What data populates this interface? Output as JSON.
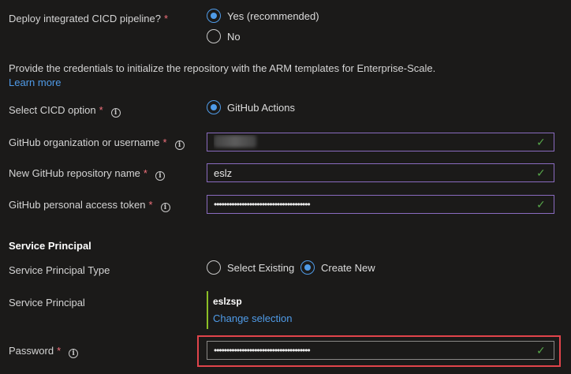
{
  "cicd": {
    "label": "Deploy integrated CICD pipeline?",
    "required_mark": "*",
    "options": [
      {
        "label": "Yes (recommended)",
        "selected": true
      },
      {
        "label": "No",
        "selected": false
      }
    ]
  },
  "description": "Provide the credentials to initialize the repository with the ARM templates for Enterprise-Scale.",
  "learn_more": "Learn more",
  "cicd_option": {
    "label": "Select CICD option",
    "required_mark": "*",
    "info_icon": "i",
    "options": [
      {
        "label": "GitHub Actions",
        "selected": true
      }
    ]
  },
  "github_org": {
    "label": "GitHub organization or username",
    "required_mark": "*",
    "info_icon": "i"
  },
  "github_repo": {
    "label": "New GitHub repository name",
    "required_mark": "*",
    "info_icon": "i",
    "value": "eslz"
  },
  "github_token": {
    "label": "GitHub personal access token",
    "required_mark": "*",
    "info_icon": "i",
    "value": "••••••••••••••••••••••••••••••••••••••"
  },
  "service_principal_section": {
    "heading": "Service Principal",
    "type_label": "Service Principal Type",
    "type_options": [
      {
        "label": "Select Existing",
        "selected": false
      },
      {
        "label": "Create New",
        "selected": true
      }
    ],
    "sp_label": "Service Principal",
    "sp_name": "eslzsp",
    "change_selection": "Change selection"
  },
  "password": {
    "label": "Password",
    "required_mark": "*",
    "info_icon": "i",
    "value": "••••••••••••••••••••••••••••••••••••••"
  },
  "colors": {
    "background": "#1b1a19",
    "accent": "#4f9be8",
    "valid_check": "#57a64a",
    "required": "#f1707b",
    "highlight_box": "#e0444b",
    "focused_border": "#8a6bbf"
  },
  "icons": {
    "check": "✓"
  }
}
